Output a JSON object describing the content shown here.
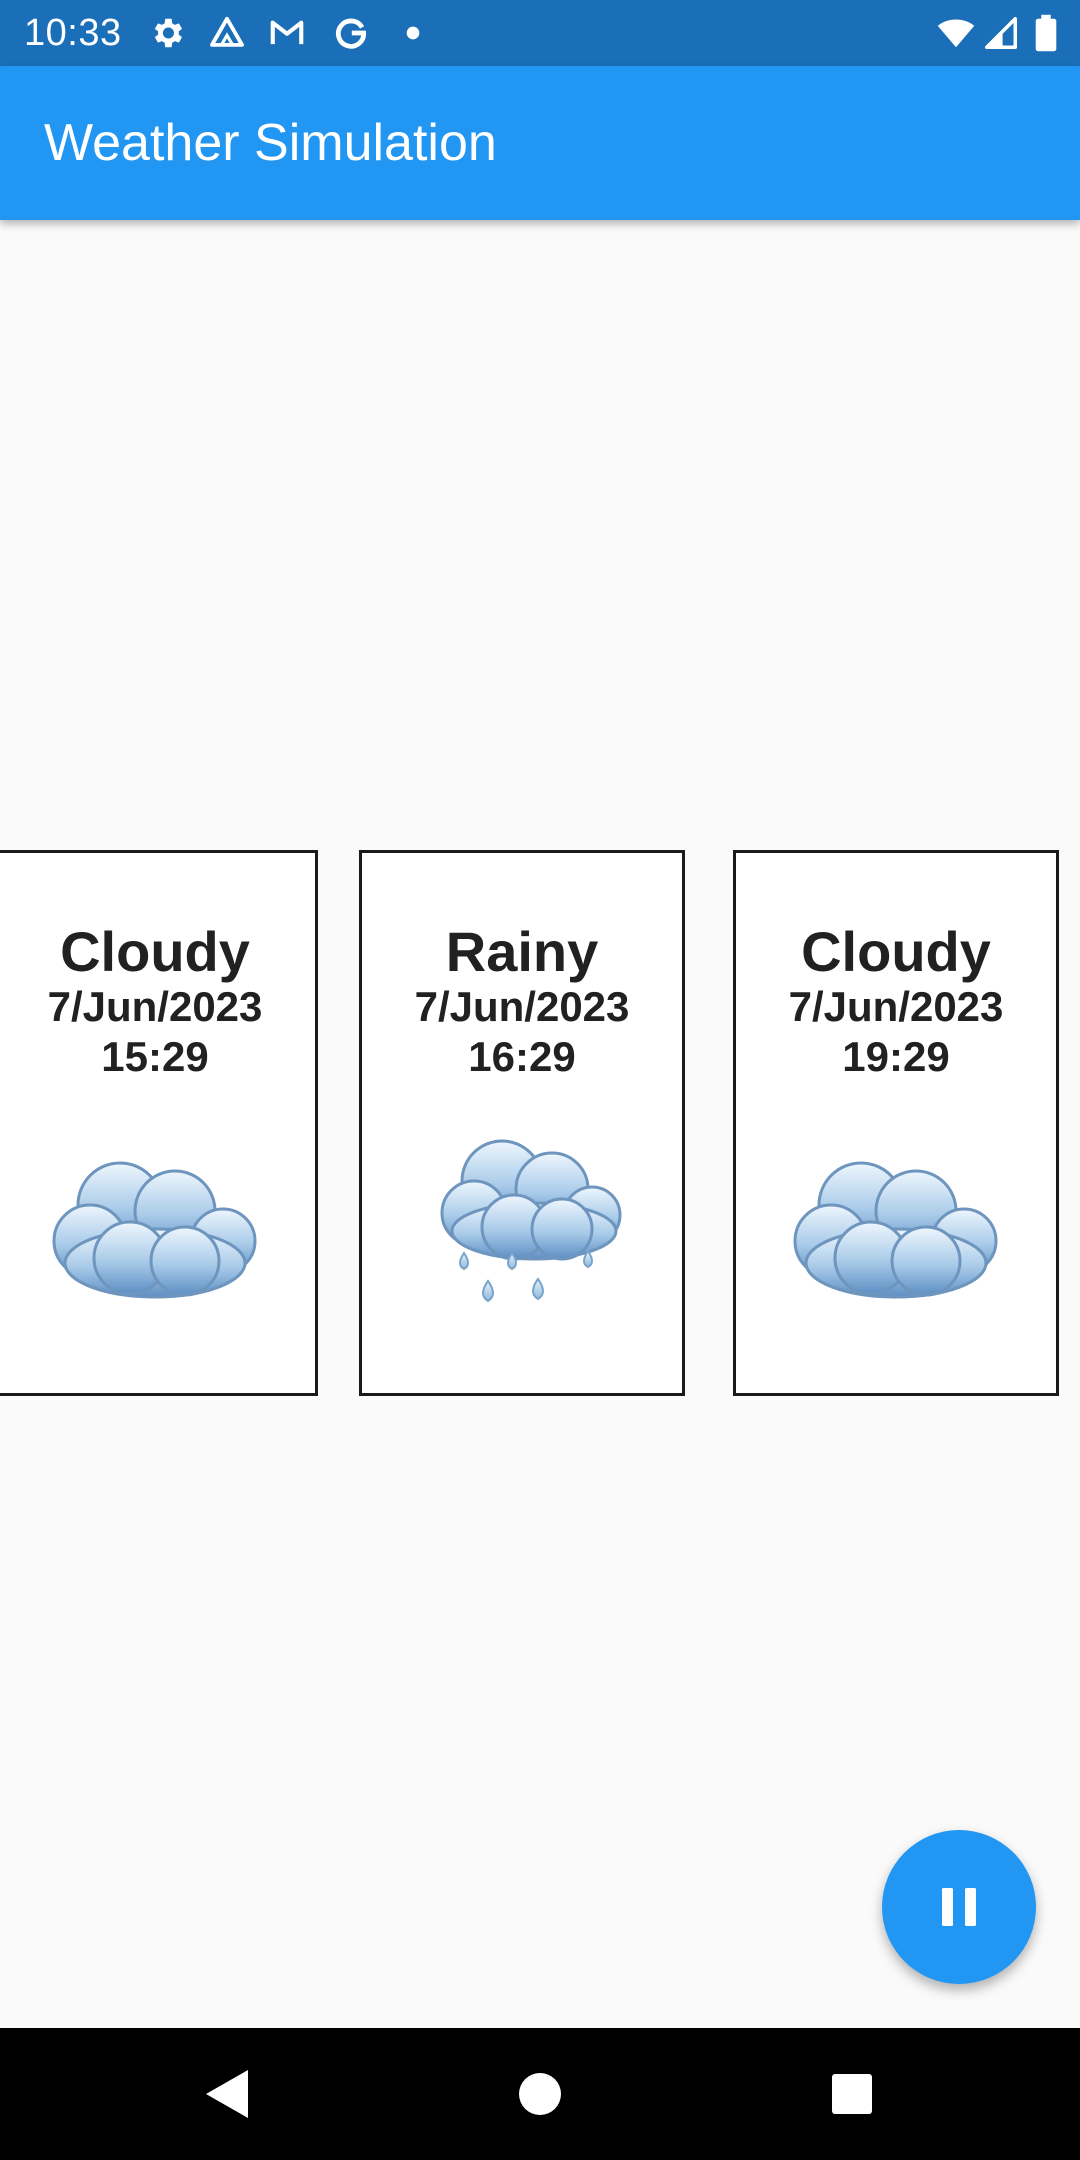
{
  "status_bar": {
    "time": "10:33",
    "left_icons": [
      "gear-icon",
      "drive-icon",
      "gmail-icon",
      "google-icon",
      "dot-icon"
    ],
    "right_icons": [
      "wifi-icon",
      "signal-icon",
      "battery-icon"
    ]
  },
  "app_bar": {
    "title": "Weather Simulation",
    "color": "#2196f3"
  },
  "forecast_cards": [
    {
      "condition": "Cloudy",
      "date": "7/Jun/2023",
      "time": "15:29",
      "icon": "cloud-icon"
    },
    {
      "condition": "Rainy",
      "date": "7/Jun/2023",
      "time": "16:29",
      "icon": "rain-cloud-icon"
    },
    {
      "condition": "Cloudy",
      "date": "7/Jun/2023",
      "time": "19:29",
      "icon": "cloud-icon"
    }
  ],
  "fab": {
    "icon": "pause-icon",
    "color": "#2196f3"
  },
  "nav_bar": {
    "buttons": [
      "back-icon",
      "home-icon",
      "recents-icon"
    ]
  }
}
